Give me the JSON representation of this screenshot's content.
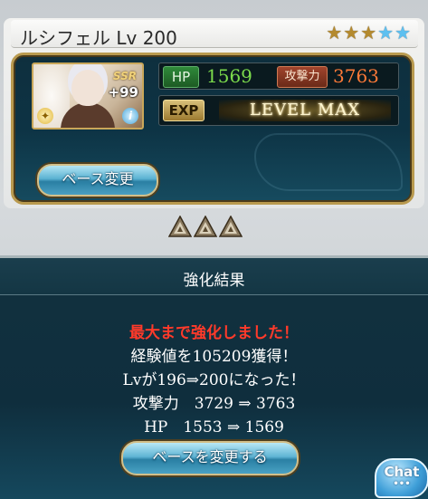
{
  "character": {
    "name": "ルシフェル Lv 200",
    "rarity": "SSR",
    "plus": "+99",
    "stars": [
      "gold",
      "gold",
      "gold",
      "blue",
      "blue"
    ]
  },
  "stats": {
    "hp_label": "HP",
    "hp_value": "1569",
    "atk_label": "攻撃力",
    "atk_value": "3763",
    "exp_label": "EXP",
    "level_max": "LEVEL MAX"
  },
  "buttons": {
    "base_change": "ベース変更",
    "change_base": "ベースを変更する",
    "chat": "Chat"
  },
  "result": {
    "title": "強化結果",
    "line_max": "最大まで強化しました！",
    "line_exp": "経験値を105209獲得！",
    "line_lv": "Lvが196⇒200になった！",
    "line_atk": "攻撃力　3729 ⇒ 3763",
    "line_hp": "HP　1553 ⇒ 1569"
  },
  "colors": {
    "hp_value": "#7cdc4c",
    "atk_value": "#ff7a38",
    "max_message": "#ff3a2a",
    "button_blue": "#5ab2d2"
  }
}
